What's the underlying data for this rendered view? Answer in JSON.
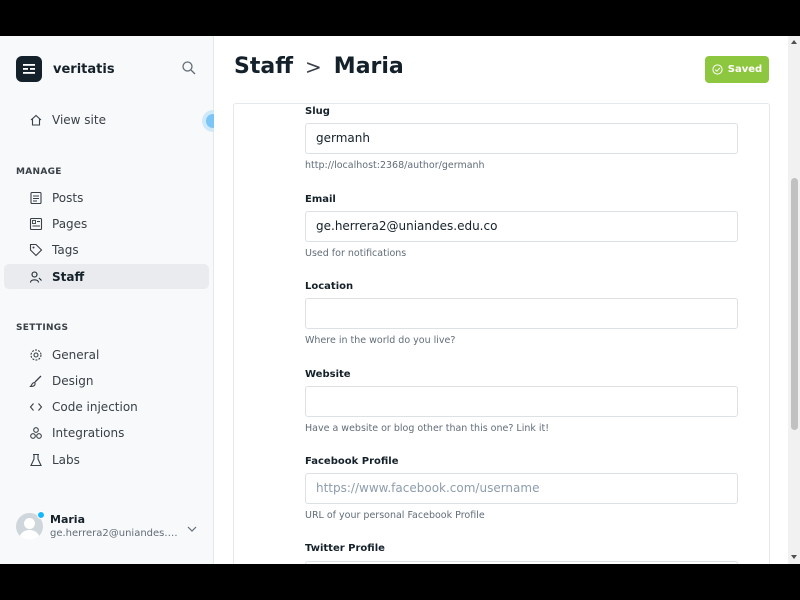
{
  "app": {
    "brand": "veritatis"
  },
  "sidebar": {
    "view_site": "View site",
    "manage_label": "MANAGE",
    "manage_items": [
      {
        "label": "Posts",
        "icon": "posts-icon"
      },
      {
        "label": "Pages",
        "icon": "pages-icon"
      },
      {
        "label": "Tags",
        "icon": "tag-icon"
      },
      {
        "label": "Staff",
        "icon": "staff-icon",
        "active": true
      }
    ],
    "settings_label": "SETTINGS",
    "settings_items": [
      {
        "label": "General",
        "icon": "gear-icon"
      },
      {
        "label": "Design",
        "icon": "brush-icon"
      },
      {
        "label": "Code injection",
        "icon": "code-icon"
      },
      {
        "label": "Integrations",
        "icon": "integrations-icon"
      },
      {
        "label": "Labs",
        "icon": "flask-icon"
      }
    ],
    "user": {
      "name": "Maria",
      "email": "ge.herrera2@uniandes.edu.co",
      "status_color": "#14b8ff"
    }
  },
  "header": {
    "breadcrumb_parent": "Staff",
    "breadcrumb_sep": ">",
    "breadcrumb_current": "Maria",
    "saved_label": "Saved",
    "saved_color": "#8dc63f"
  },
  "form": {
    "slug": {
      "label": "Slug",
      "value": "germanh",
      "hint": "http://localhost:2368/author/germanh"
    },
    "email": {
      "label": "Email",
      "value": "ge.herrera2@uniandes.edu.co",
      "hint": "Used for notifications"
    },
    "location": {
      "label": "Location",
      "value": "",
      "hint": "Where in the world do you live?"
    },
    "website": {
      "label": "Website",
      "value": "",
      "hint": "Have a website or blog other than this one? Link it!"
    },
    "facebook": {
      "label": "Facebook Profile",
      "value": "",
      "placeholder": "https://www.facebook.com/username",
      "hint": "URL of your personal Facebook Profile"
    },
    "twitter": {
      "label": "Twitter Profile"
    }
  }
}
